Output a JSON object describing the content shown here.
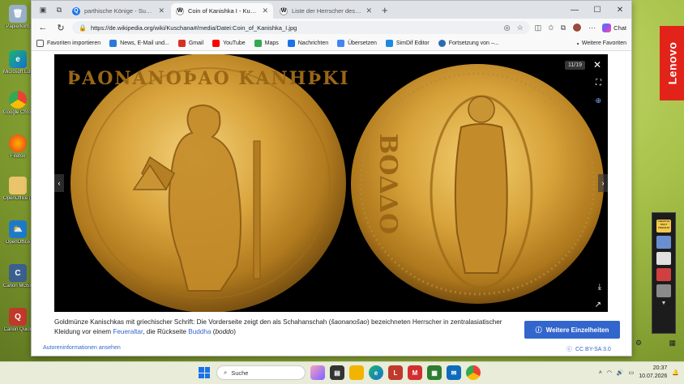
{
  "desktop": {
    "icons": [
      {
        "label": "Papierkorb"
      },
      {
        "label": "Microsoft Edge"
      },
      {
        "label": "Google Chrome"
      },
      {
        "label": "Firefox"
      },
      {
        "label": "OpenOffice (64) Installer"
      },
      {
        "label": "OpenOffice"
      },
      {
        "label": "Canon MG5xxx On-Screen..."
      },
      {
        "label": "Canon Quick"
      }
    ],
    "brand": "Lenovo",
    "side_panel_label": "CREATIVE PAINT PREMIUM"
  },
  "browser": {
    "tabs": [
      {
        "title": "parthische Könige - Suchen",
        "active": false
      },
      {
        "title": "Coin of Kanishka I - Kuschana – W",
        "active": true
      },
      {
        "title": "Liste der Herrscher des Partherrei",
        "active": false
      }
    ],
    "address": {
      "url": "https://de.wikipedia.org/wiki/Kuschana#/media/Datei:Coin_of_Kanishka_I.jpg"
    },
    "chat_label": "Chat",
    "bookmarks": [
      {
        "label": "Favoriten importieren",
        "color": "#555555"
      },
      {
        "label": "News, E-Mail und...",
        "color": "#2b79d7"
      },
      {
        "label": "Gmail",
        "color": "#d93025"
      },
      {
        "label": "YouTube",
        "color": "#ff0000"
      },
      {
        "label": "Maps",
        "color": "#34a853"
      },
      {
        "label": "Nachrichten",
        "color": "#1a73e8"
      },
      {
        "label": "Übersetzen",
        "color": "#4285f4"
      },
      {
        "label": "SimDif Editor",
        "color": "#1e88e5"
      },
      {
        "label": "Fortsetzung von –...",
        "color": "#2b6cb0"
      }
    ],
    "bookmarks_more": "Weitere Favoriten"
  },
  "viewer": {
    "counter": "11/19",
    "coin_left_legend": "ϷΑΟΝΑΝΟϷΑΟ ΚΑΝΗϷΚΙ",
    "coin_right_legend": "ΒΟΔΔΟ",
    "caption": {
      "part1": "Goldmünze Kanischkas mit griechischer Schrift: Die Vorderseite zeigt den als Schahanschah (",
      "term1": "šaonanošao",
      "part2": ") bezeichneten Herrscher in zentralasiatischer Kleidung vor einem ",
      "link1": "Feueraltar",
      "part3": ", die Rückseite ",
      "link2": "Buddha",
      "part4": " (",
      "term2": "boddo",
      "part5": ")"
    },
    "details_button": "Weitere Einzelheiten",
    "author_link": "Autoreninformationen ansehen",
    "license": "CC BY-SA 3.0"
  },
  "taskbar": {
    "search_placeholder": "Suche",
    "time": "20:37",
    "date": "10.07.2026"
  }
}
